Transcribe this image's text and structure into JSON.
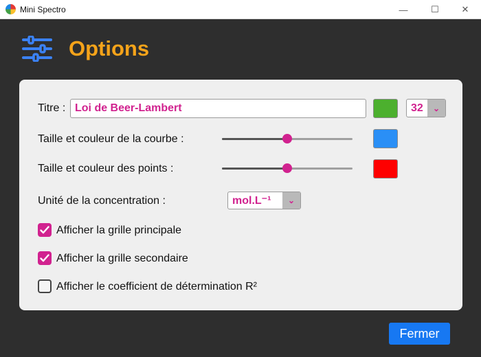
{
  "window": {
    "title": "Mini Spectro",
    "minimize_glyph": "—",
    "maximize_glyph": "☐",
    "close_glyph": "✕"
  },
  "header": {
    "title": "Options",
    "icon": "sliders-icon",
    "accent": "#f5a31a"
  },
  "title_row": {
    "label": "Titre :",
    "value": "Loi de Beer-Lambert",
    "color": "#4cb02e",
    "font_size": "32"
  },
  "curve_row": {
    "label": "Taille et couleur de la courbe :",
    "slider_level": 0.5,
    "color": "#2a8ff6"
  },
  "points_row": {
    "label": "Taille et couleur des points :",
    "slider_level": 0.5,
    "color": "#fe0000"
  },
  "unit_row": {
    "label": "Unité de la concentration :",
    "value": "mol.L⁻¹"
  },
  "options": [
    {
      "label": "Afficher la grille principale",
      "checked": true
    },
    {
      "label": "Afficher la grille secondaire",
      "checked": true
    },
    {
      "label": "Afficher le coefficient de détermination R²",
      "checked": false
    }
  ],
  "close_button": {
    "label": "Fermer",
    "color": "#1778f2"
  }
}
